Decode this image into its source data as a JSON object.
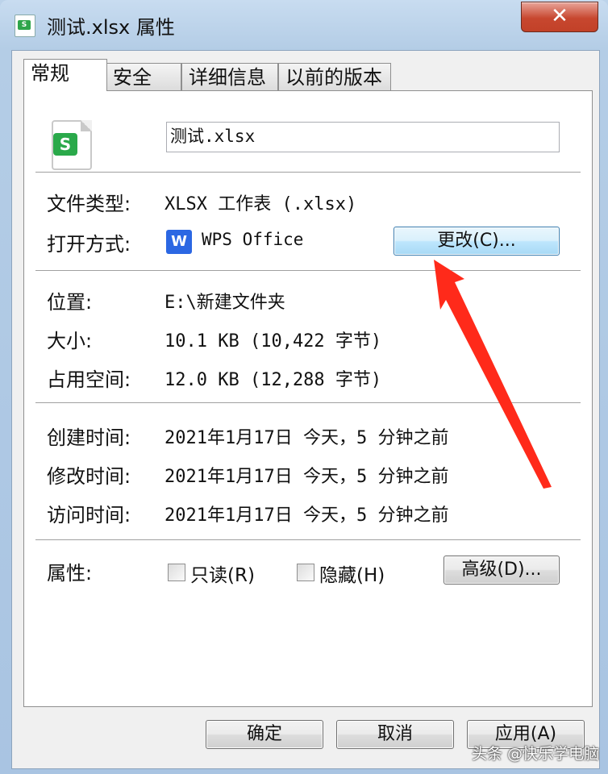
{
  "window": {
    "title": "测试.xlsx 属性",
    "app_icon_text": "S",
    "close_glyph": "✕"
  },
  "tabs": [
    {
      "label": "常规",
      "active": true
    },
    {
      "label": "安全",
      "active": false
    },
    {
      "label": "详细信息",
      "active": false
    },
    {
      "label": "以前的版本",
      "active": false
    }
  ],
  "general": {
    "file_icon_badge": "S",
    "file_name": "测试.xlsx",
    "file_type_label": "文件类型:",
    "file_type_value": "XLSX 工作表 (.xlsx)",
    "open_with_label": "打开方式:",
    "open_with_icon_text": "W",
    "open_with_app": "WPS Office",
    "change_button": "更改(C)...",
    "location_label": "位置:",
    "location_value": "E:\\新建文件夹",
    "size_label": "大小:",
    "size_value": "10.1 KB (10,422 字节)",
    "size_on_disk_label": "占用空间:",
    "size_on_disk_value": "12.0 KB (12,288 字节)",
    "created_label": "创建时间:",
    "created_value": "2021年1月17日 今天，5 分钟之前",
    "modified_label": "修改时间:",
    "modified_value": "2021年1月17日 今天，5 分钟之前",
    "accessed_label": "访问时间:",
    "accessed_value": "2021年1月17日 今天，5 分钟之前",
    "attributes_label": "属性:",
    "readonly_label": "只读(R)",
    "readonly_checked": false,
    "hidden_label": "隐藏(H)",
    "hidden_checked": false,
    "advanced_button": "高级(D)..."
  },
  "footer": {
    "ok": "确定",
    "cancel": "取消",
    "apply": "应用(A)"
  },
  "watermark": "头条 @快乐学电脑",
  "colors": {
    "annotation_arrow": "#ff2a1a",
    "excel_green": "#2aa94a",
    "wps_blue": "#2b67e3"
  }
}
